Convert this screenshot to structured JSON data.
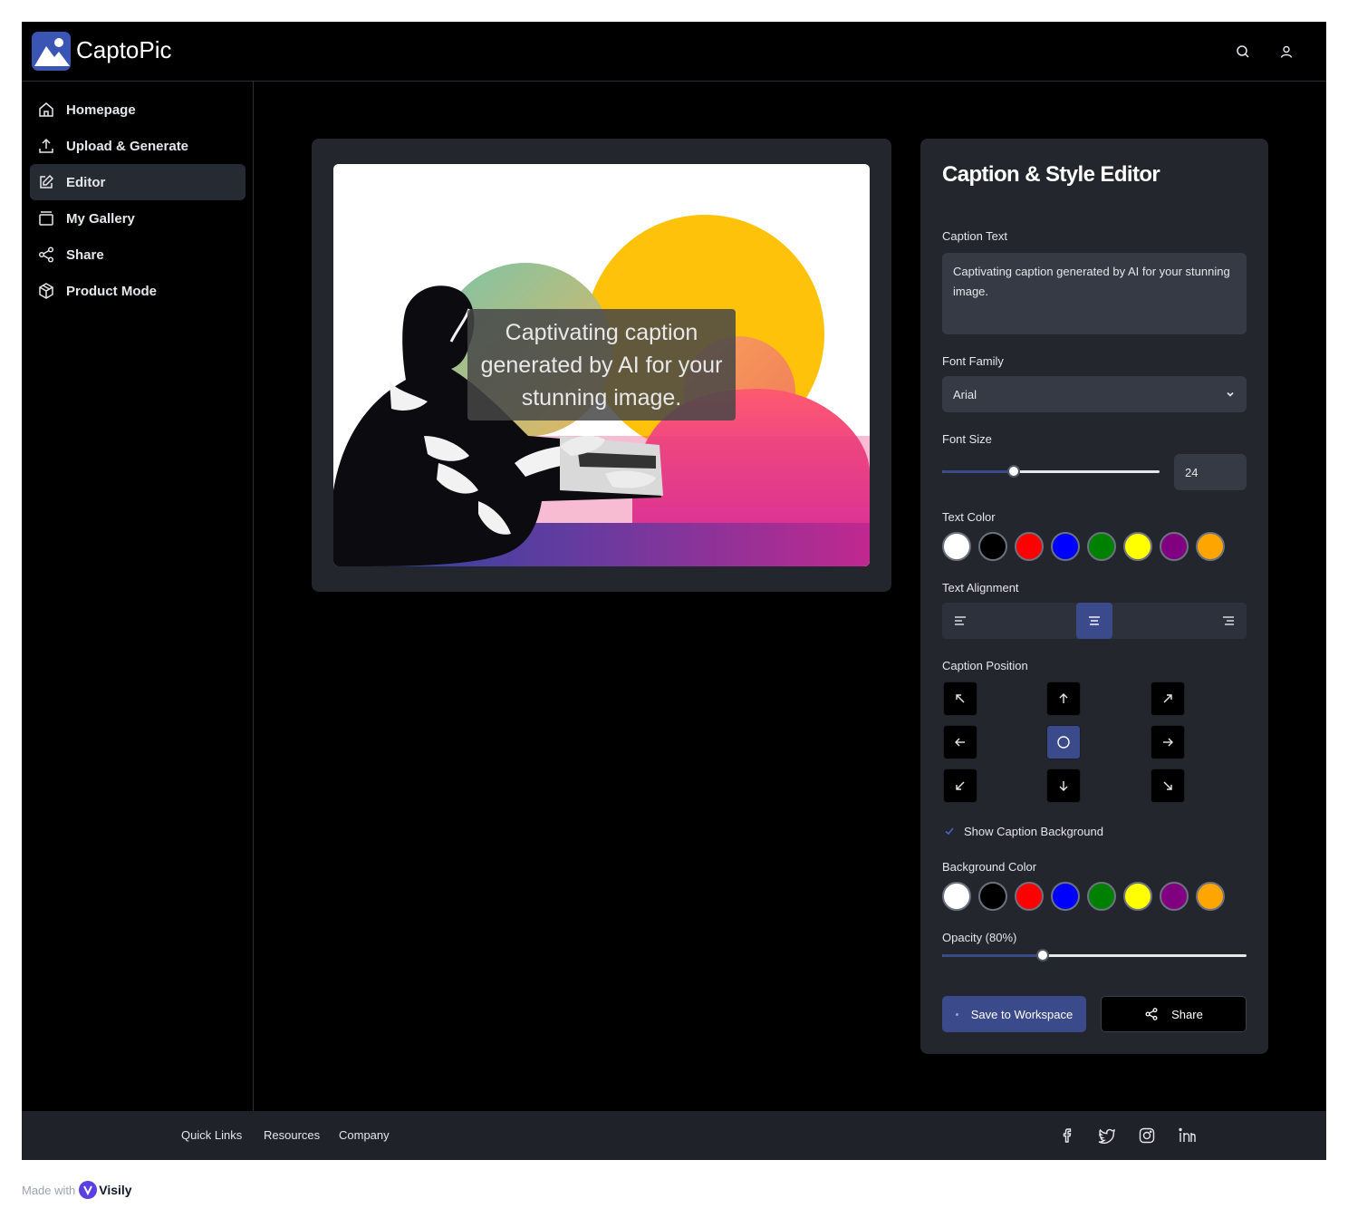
{
  "app": {
    "name": "CaptoPic"
  },
  "header": {
    "icons": [
      "search-icon",
      "user-icon"
    ]
  },
  "sidebar": {
    "items": [
      {
        "label": "Homepage",
        "icon": "home-icon",
        "active": false
      },
      {
        "label": "Upload & Generate",
        "icon": "upload-icon",
        "active": false
      },
      {
        "label": "Editor",
        "icon": "edit-icon",
        "active": true
      },
      {
        "label": "My Gallery",
        "icon": "gallery-icon",
        "active": false
      },
      {
        "label": "Share",
        "icon": "share-icon",
        "active": false
      },
      {
        "label": "Product Mode",
        "icon": "box-icon",
        "active": false
      }
    ]
  },
  "preview": {
    "caption": "Captivating caption generated by AI for your stunning image."
  },
  "editor": {
    "title": "Caption & Style Editor",
    "caption_text_label": "Caption Text",
    "caption_text_value": "Captivating caption generated by AI for your stunning image.",
    "font_family_label": "Font Family",
    "font_family_value": "Arial",
    "font_size_label": "Font Size",
    "font_size_value": "24",
    "font_size_fraction": 0.33,
    "text_color_label": "Text Color",
    "text_alignment_label": "Text Alignment",
    "text_alignment_selected": "center",
    "caption_position_label": "Caption Position",
    "caption_position_selected": "center",
    "show_background_label": "Show Caption Background",
    "show_background_checked": true,
    "background_color_label": "Background Color",
    "opacity_label": "Opacity (80%)",
    "opacity_fraction": 0.33,
    "save_label": "Save to Workspace",
    "share_label": "Share"
  },
  "colors": [
    "#ffffff",
    "#000000",
    "#ff0000",
    "#0000ff",
    "#008000",
    "#ffff00",
    "#800080",
    "#ffa500"
  ],
  "footer": {
    "links": [
      "Quick Links",
      "Resources",
      "Company"
    ],
    "social_icons": [
      "facebook-icon",
      "twitter-icon",
      "instagram-icon",
      "linkedin-icon"
    ]
  },
  "watermark": {
    "prefix": "Made with",
    "brand": "Visily"
  }
}
